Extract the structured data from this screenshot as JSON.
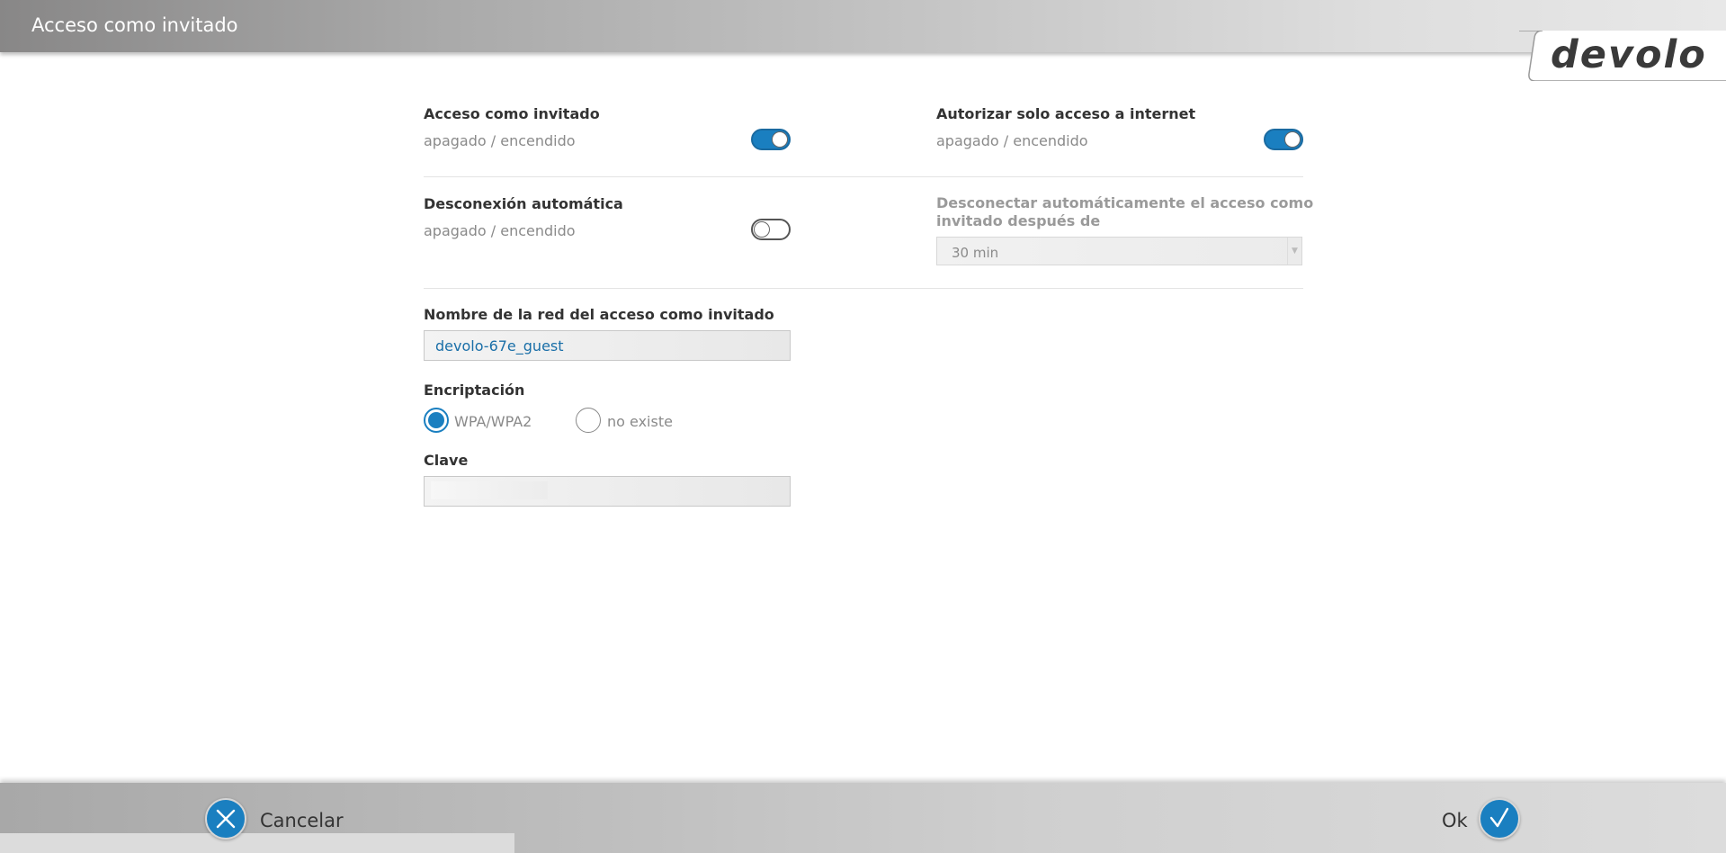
{
  "header": {
    "title": "Acceso como invitado",
    "logo": "devolo"
  },
  "guest_access": {
    "title": "Acceso como invitado",
    "sub": "apagado / encendido",
    "state": "on"
  },
  "internet_only": {
    "title": "Autorizar solo acceso a internet",
    "sub": "apagado / encendido",
    "state": "on"
  },
  "auto_disconnect": {
    "title": "Desconexión automática",
    "sub": "apagado / encendido",
    "state": "off"
  },
  "disconnect_after": {
    "title": "Desconectar automáticamente el acceso como invitado después de",
    "value": "30 min"
  },
  "network_name": {
    "title": "Nombre de la red del acceso como invitado",
    "value": "devolo-67e_guest"
  },
  "encryption": {
    "title": "Encriptación",
    "options": [
      "WPA/WPA2",
      "no existe"
    ],
    "selected": "WPA/WPA2"
  },
  "key": {
    "title": "Clave",
    "value": ""
  },
  "footer": {
    "cancel_label": "Cancelar",
    "ok_label": "Ok"
  },
  "colors": {
    "accent": "#1a7fc0"
  }
}
